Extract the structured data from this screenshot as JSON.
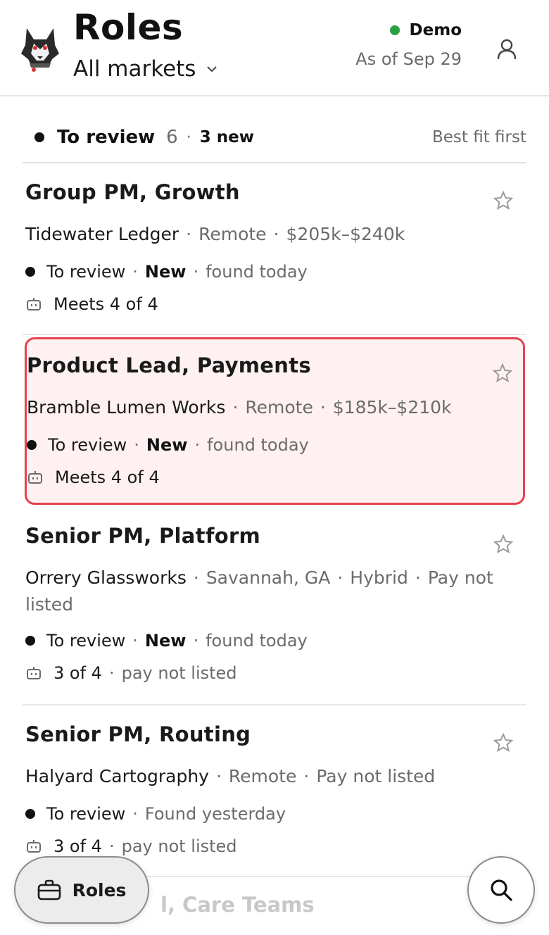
{
  "header": {
    "title": "Roles",
    "market": "All markets",
    "mode": "Demo",
    "as_of": "As of Sep 29",
    "logo_icon": "husky-logo",
    "status_color": "#2ea043"
  },
  "section": {
    "status": "To review",
    "count": "6",
    "separator": "·",
    "new_count": "3 new",
    "sort": "Best fit first"
  },
  "roles": [
    {
      "title": "Group PM, Growth",
      "company": "Tidewater Ledger",
      "location": "Remote",
      "pay": "$205k–$240k",
      "status": "To review",
      "new_label": "New",
      "found": "found today",
      "match": "Meets 4 of 4"
    },
    {
      "title": "Product Lead, Payments",
      "company": "Bramble Lumen Works",
      "location": "Remote",
      "pay": "$185k–$210k",
      "status": "To review",
      "new_label": "New",
      "found": "found today",
      "match": "Meets 4 of 4",
      "highlight_color": "#e5424d"
    },
    {
      "title": "Senior PM, Platform",
      "company": "Orrery Glassworks",
      "location": "Savannah, GA",
      "work_mode": "Hybrid",
      "pay": "Pay not listed",
      "status": "To review",
      "new_label": "New",
      "found": "found today",
      "match": "3 of 4",
      "match_note": "pay not listed"
    },
    {
      "title": "Senior PM, Routing",
      "company": "Halyard Cartography",
      "location": "Remote",
      "pay": "Pay not listed",
      "status": "To review",
      "found": "Found yesterday",
      "match": "3 of 4",
      "match_note": "pay not listed"
    },
    {
      "title_partial": "l, Care Teams"
    }
  ],
  "nav": {
    "roles_label": "Roles",
    "roles_icon": "briefcase-icon",
    "search_icon": "search-icon"
  }
}
